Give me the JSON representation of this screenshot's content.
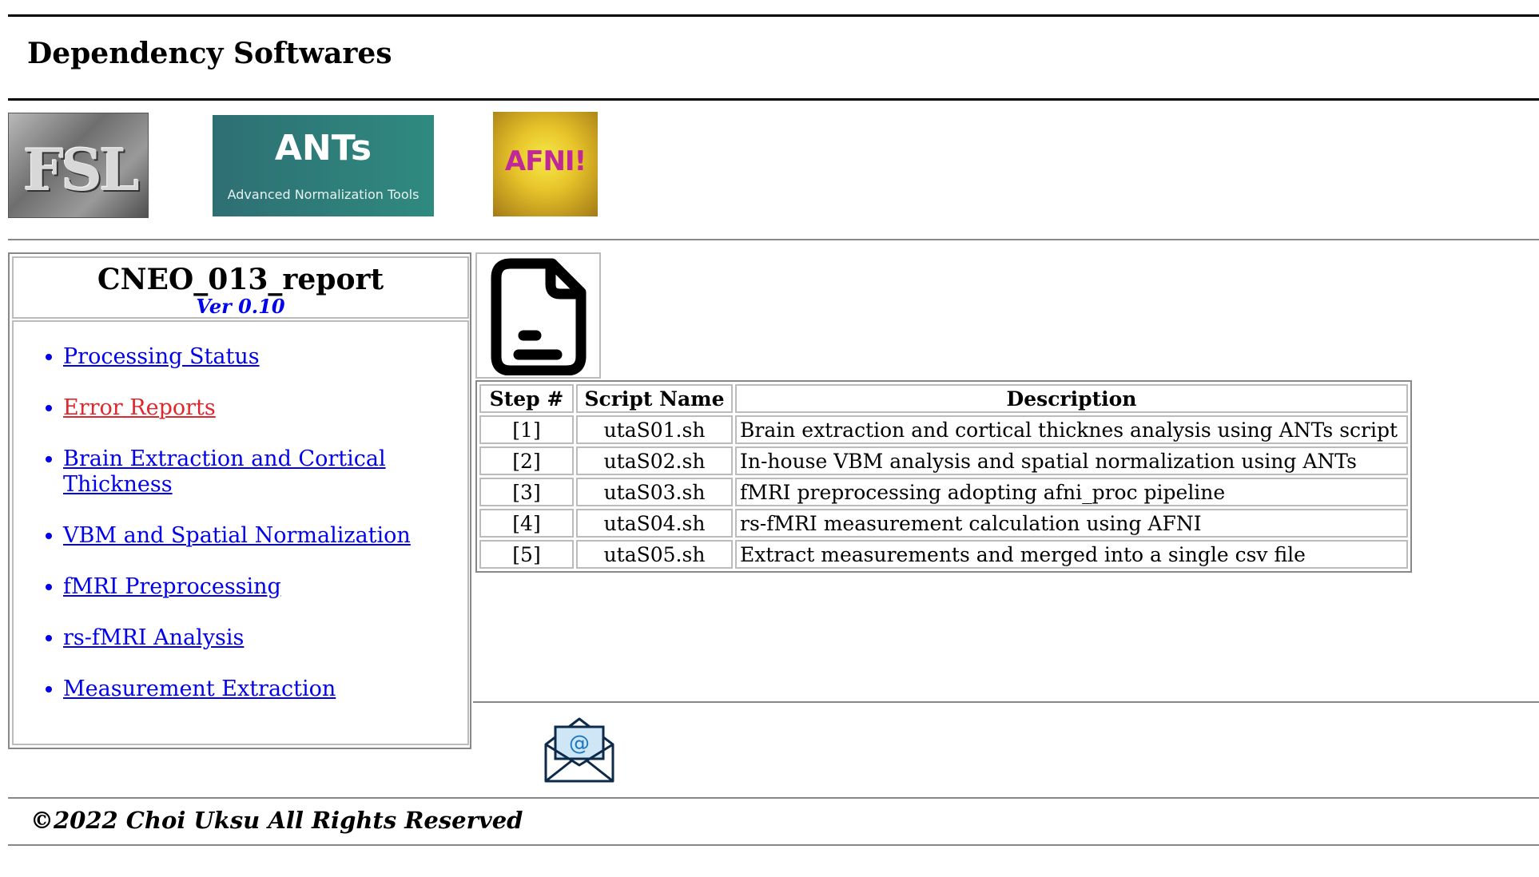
{
  "header": {
    "title": "Dependency Softwares"
  },
  "logos": {
    "fsl": {
      "text": "FSL"
    },
    "ants": {
      "title": "ANTs",
      "subtitle": "Advanced Normalization Tools"
    },
    "afni": {
      "text": "AFNI!"
    }
  },
  "sidebar": {
    "title": "CNEO_013_report",
    "version": "Ver 0.10",
    "items": [
      {
        "label": "Processing Status"
      },
      {
        "label": "Error Reports"
      },
      {
        "label": "Brain Extraction and Cortical Thickness"
      },
      {
        "label": "VBM and Spatial Normalization"
      },
      {
        "label": "fMRI Preprocessing"
      },
      {
        "label": "rs-fMRI Analysis"
      },
      {
        "label": "Measurement Extraction"
      }
    ]
  },
  "icons": {
    "document": "document-icon",
    "mail": "mail-icon"
  },
  "colors": {
    "link": "#0000ee",
    "error_link": "#e0262b"
  },
  "table": {
    "headers": [
      "Step #",
      "Script Name",
      "Description"
    ],
    "rows": [
      {
        "step": "[1]",
        "script": "utaS01.sh",
        "description": "Brain extraction and cortical thicknes analysis using ANTs script"
      },
      {
        "step": "[2]",
        "script": "utaS02.sh",
        "description": "In-house VBM analysis and spatial normalization using ANTs"
      },
      {
        "step": "[3]",
        "script": "utaS03.sh",
        "description": "fMRI preprocessing adopting afni_proc pipeline"
      },
      {
        "step": "[4]",
        "script": "utaS04.sh",
        "description": "rs-fMRI measurement calculation using AFNI"
      },
      {
        "step": "[5]",
        "script": "utaS05.sh",
        "description": "Extract measurements and merged into a single csv file"
      }
    ]
  },
  "footer": {
    "copyright": "©2022 Choi Uksu All Rights Reserved"
  }
}
